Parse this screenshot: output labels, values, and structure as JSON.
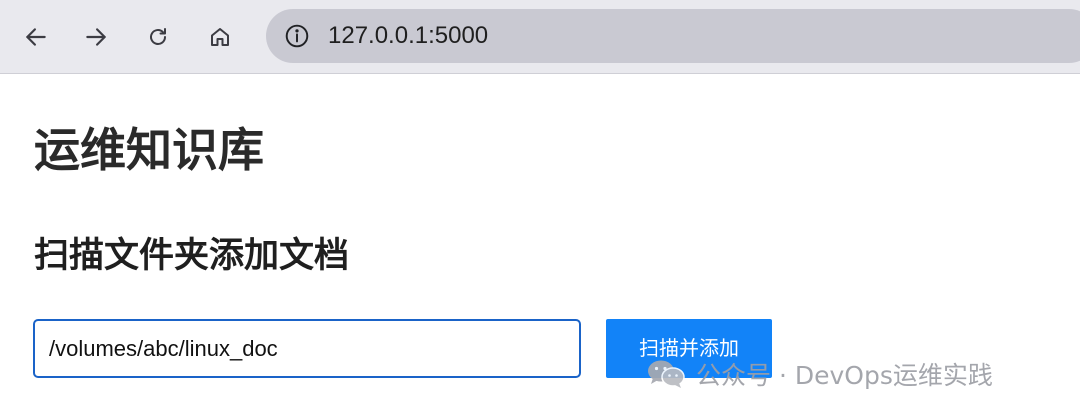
{
  "browser": {
    "url": "127.0.0.1:5000",
    "icons": {
      "back": "arrow-left-icon",
      "forward": "arrow-right-icon",
      "reload": "reload-icon",
      "home": "home-icon",
      "site_info": "info-icon"
    }
  },
  "page": {
    "title": "运维知识库",
    "section_title": "扫描文件夹添加文档",
    "folder_input": {
      "value": "/volumes/abc/linux_doc",
      "placeholder": ""
    },
    "scan_button_label": "扫描并添加"
  },
  "watermark": {
    "text": "公众号 · DevOps运维实践",
    "icon": "wechat-icon"
  },
  "colors": {
    "toolbar_bg": "#e9e9ee",
    "omnibox_bg": "#c9c9d2",
    "accent": "#1283f8",
    "input_border": "#1a63c8"
  }
}
